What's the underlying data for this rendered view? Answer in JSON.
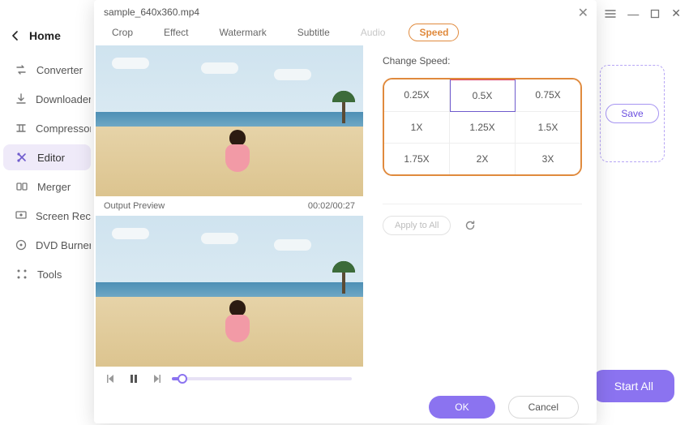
{
  "window": {
    "menu_icon": "menu",
    "minimize": "—",
    "maximize": "□",
    "close": "✕"
  },
  "sidebar": {
    "home": "Home",
    "items": [
      {
        "label": "Converter"
      },
      {
        "label": "Downloader"
      },
      {
        "label": "Compressor"
      },
      {
        "label": "Editor"
      },
      {
        "label": "Merger"
      },
      {
        "label": "Screen Record"
      },
      {
        "label": "DVD Burner"
      },
      {
        "label": "Tools"
      }
    ]
  },
  "background": {
    "save": "Save",
    "start_all": "Start All"
  },
  "dialog": {
    "title": "sample_640x360.mp4",
    "tabs": [
      {
        "label": "Crop"
      },
      {
        "label": "Effect"
      },
      {
        "label": "Watermark"
      },
      {
        "label": "Subtitle"
      },
      {
        "label": "Audio",
        "disabled": true
      },
      {
        "label": "Speed",
        "active": true
      }
    ],
    "output_preview_label": "Output Preview",
    "time": "00:02/00:27",
    "change_speed_label": "Change Speed:",
    "speeds": [
      "0.25X",
      "0.5X",
      "0.75X",
      "1X",
      "1.25X",
      "1.5X",
      "1.75X",
      "2X",
      "3X"
    ],
    "selected_speed": "0.5X",
    "apply_all": "Apply to All",
    "ok": "OK",
    "cancel": "Cancel"
  }
}
